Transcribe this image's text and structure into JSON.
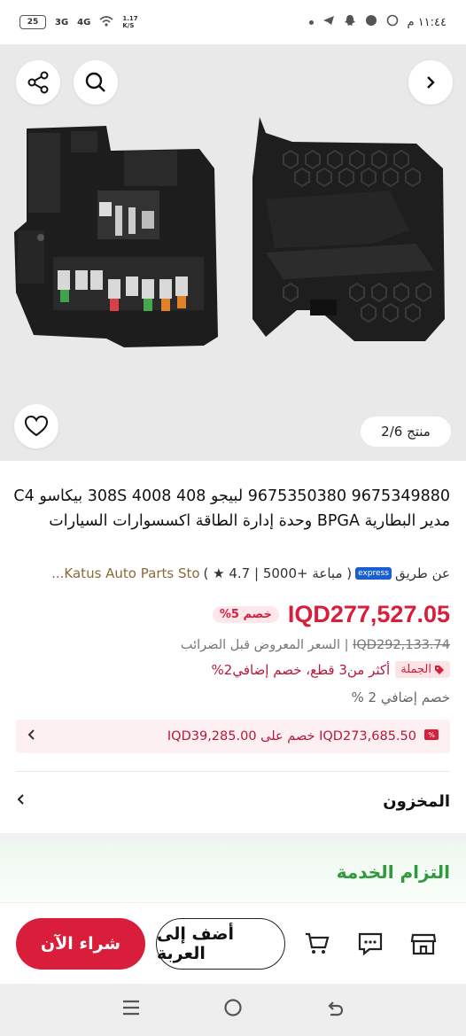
{
  "status_bar": {
    "time": "١١:٤٤ م",
    "battery": "25",
    "net1": "3G",
    "net2": "4G",
    "speed": "1.17 K/S"
  },
  "gallery": {
    "counter": "منتج 2/6"
  },
  "product": {
    "title": "9675349880 9675350380 لبيجو 408 4008 308S بيكاسو C4 مدير البطارية BPGA وحدة إدارة الطاقة اكسسوارات السيارات",
    "seller_prefix": "عن طريق",
    "express_label": "express",
    "stats": "( مباعة +5000 | 4.7 ★ )",
    "store_name": "Katus Auto Parts Sto...",
    "price": "IQD277,527.05",
    "discount_badge": "خصم 5%",
    "old_price": "IQD292,133.74",
    "old_price_label": "| السعر المعروض قبل الضرائب",
    "bulk_tag": "الجملة",
    "bulk_text": "أكثر من3 قطع، خصم إضافي2%",
    "extra_discount": "خصم إضافي 2 %",
    "promo_text": "IQD273,685.50 خصم على IQD39,285.00",
    "stock_label": "المخزون"
  },
  "service": {
    "title": "التزام الخدمة"
  },
  "actions": {
    "buy_now": "شراء الآن",
    "add_to_cart": "أضف إلى العربة"
  },
  "colors": {
    "accent": "#d81e3a",
    "service_green": "#2e9a3c"
  }
}
